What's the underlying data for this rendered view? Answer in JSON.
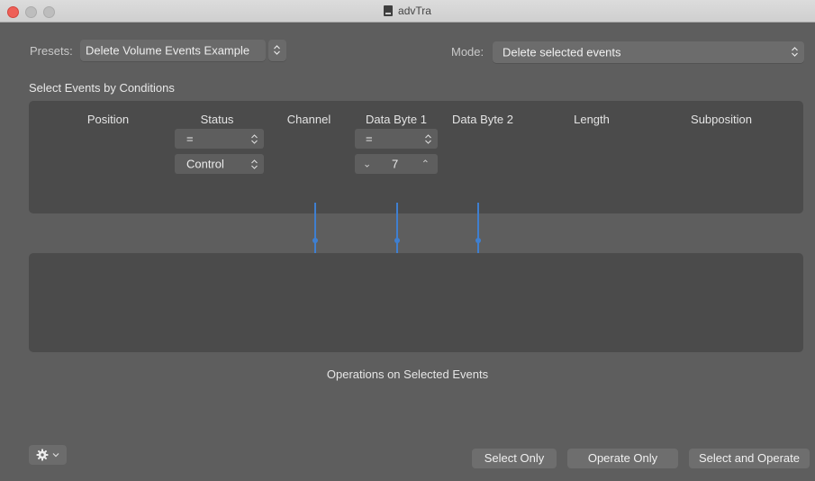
{
  "window": {
    "title": "advTra"
  },
  "presets": {
    "label": "Presets:",
    "value": "Delete Volume Events Example"
  },
  "mode": {
    "label": "Mode:",
    "value": "Delete selected events"
  },
  "conditions": {
    "section_title": "Select Events by Conditions",
    "columns": [
      "Position",
      "Status",
      "Channel",
      "Data Byte 1",
      "Data Byte 2",
      "Length",
      "Subposition"
    ],
    "status_operator": "=",
    "status_value": "Control",
    "data_byte1_operator": "=",
    "data_byte1_value": "7",
    "data_byte1_decrement": "⌄",
    "data_byte1_increment": "⌃"
  },
  "operations": {
    "section_title": "Operations on Selected Events"
  },
  "footer": {
    "select_only": "Select Only",
    "operate_only": "Operate Only",
    "select_and_operate": "Select and Operate"
  },
  "colors": {
    "accent": "#3f7fd0",
    "panel": "#4b4b4b",
    "background": "#5e5e5e"
  },
  "icons": {
    "settings": "gear-icon",
    "stepper": "up-down-chevron-icon",
    "document": "document-icon"
  }
}
